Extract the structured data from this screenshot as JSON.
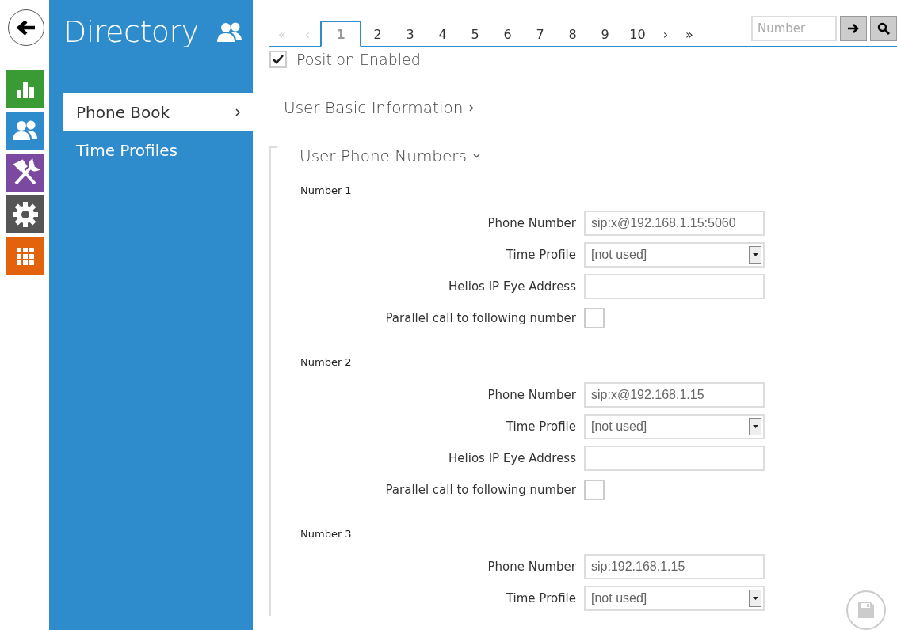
{
  "sidebar": {
    "title": "Directory",
    "items": [
      {
        "label": "Phone Book",
        "selected": true
      },
      {
        "label": "Time Profiles",
        "selected": false
      }
    ]
  },
  "pager": {
    "prev_buttons": [
      {
        "label": "«",
        "disabled": true
      },
      {
        "label": "‹",
        "disabled": true
      }
    ],
    "pages": [
      {
        "label": "1",
        "selected": true
      },
      {
        "label": "2",
        "selected": false
      },
      {
        "label": "3",
        "selected": false
      },
      {
        "label": "4",
        "selected": false
      },
      {
        "label": "5",
        "selected": false
      },
      {
        "label": "6",
        "selected": false
      },
      {
        "label": "7",
        "selected": false
      },
      {
        "label": "8",
        "selected": false
      },
      {
        "label": "9",
        "selected": false
      },
      {
        "label": "10",
        "selected": false
      }
    ],
    "next_buttons": [
      {
        "label": "›",
        "disabled": false
      },
      {
        "label": "»",
        "disabled": false
      }
    ],
    "search": {
      "placeholder": "Number"
    }
  },
  "position_enabled": {
    "label": "Position Enabled",
    "checked": true
  },
  "sections": [
    {
      "title": "User Basic Information",
      "expanded": false
    },
    {
      "title": "User Phone Numbers",
      "expanded": true
    }
  ],
  "numbers": [
    {
      "title": "Number 1",
      "fields": [
        {
          "kind": "text",
          "label": "Phone Number",
          "value": "sip:x@192.168.1.15:5060"
        },
        {
          "kind": "select",
          "label": "Time Profile",
          "value": "[not used]"
        },
        {
          "kind": "text",
          "label": "Helios IP Eye Address"
        },
        {
          "kind": "checkbox",
          "label": "Parallel call to following number",
          "checked": false
        }
      ]
    },
    {
      "title": "Number 2",
      "fields": [
        {
          "kind": "text",
          "label": "Phone Number",
          "value": "sip:x@192.168.1.15"
        },
        {
          "kind": "select",
          "label": "Time Profile",
          "value": "[not used]"
        },
        {
          "kind": "text",
          "label": "Helios IP Eye Address"
        },
        {
          "kind": "checkbox",
          "label": "Parallel call to following number",
          "checked": false
        }
      ]
    },
    {
      "title": "Number 3",
      "fields": [
        {
          "kind": "text",
          "label": "Phone Number",
          "value": "sip:192.168.1.15"
        },
        {
          "kind": "select",
          "label": "Time Profile",
          "value": "[not used]"
        }
      ]
    }
  ]
}
